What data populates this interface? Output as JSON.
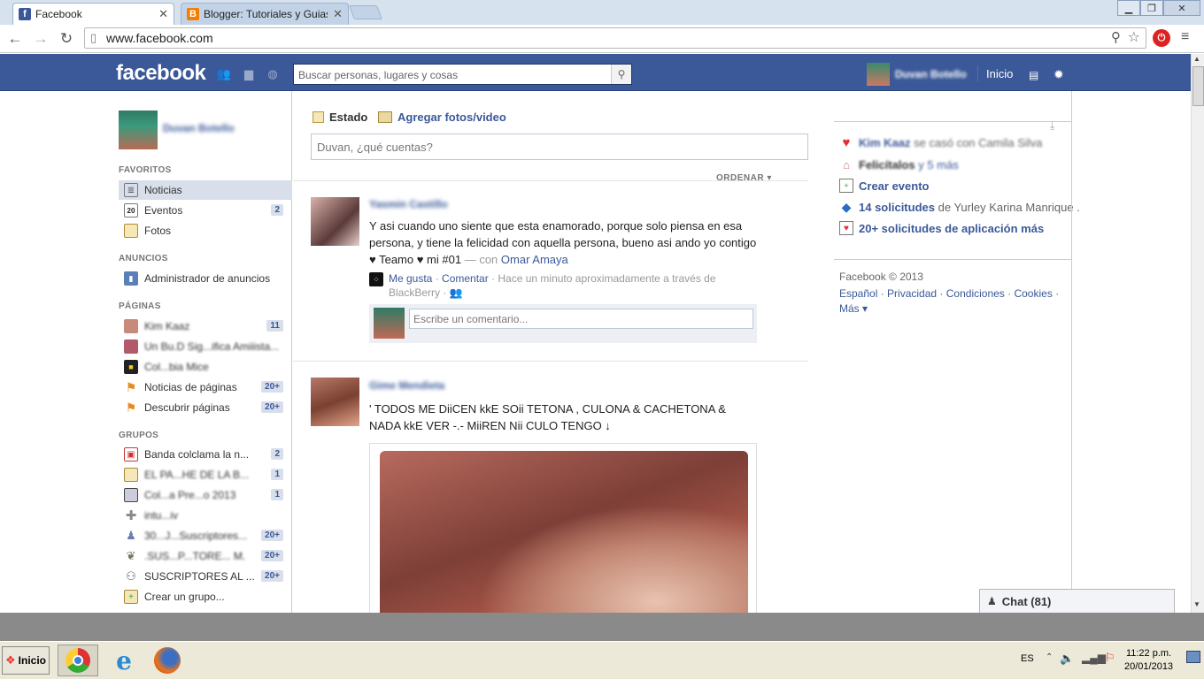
{
  "browser": {
    "tabs": [
      {
        "title": "Facebook",
        "active": true
      },
      {
        "title": "Blogger: Tutoriales y Guias. -",
        "active": false
      }
    ],
    "url": "www.facebook.com",
    "window_controls": {
      "minimize": "▭",
      "maximize": "❐",
      "close": "✕"
    }
  },
  "fbbar": {
    "logo": "facebook",
    "search_placeholder": "Buscar personas, lugares y cosas",
    "user_name": "Duvan Botello",
    "home": "Inicio"
  },
  "left": {
    "profile_name": "Duvan Botello",
    "sections": {
      "favoritos": "FAVORITOS",
      "anuncios": "ANUNCIOS",
      "paginas": "PÁGINAS",
      "grupos": "GRUPOS"
    },
    "favoritos": [
      {
        "label": "Noticias",
        "count": ""
      },
      {
        "label": "Eventos",
        "count": "2"
      },
      {
        "label": "Fotos",
        "count": ""
      }
    ],
    "anuncios": [
      {
        "label": "Administrador de anuncios",
        "count": ""
      }
    ],
    "paginas": [
      {
        "label": "Kim Kaaz",
        "count": "11"
      },
      {
        "label": "Un Bu.D Sig...ifica Amiiista...",
        "count": ""
      },
      {
        "label": "Col...bia Mice",
        "count": ""
      },
      {
        "label": "Noticias de páginas",
        "count": "20+"
      },
      {
        "label": "Descubrir páginas",
        "count": "20+"
      }
    ],
    "grupos": [
      {
        "label": "Banda colclama la n...",
        "count": "2"
      },
      {
        "label": "EL PA...HE DE LA B...",
        "count": "1"
      },
      {
        "label": "Col...a Pre...o 2013",
        "count": "1"
      },
      {
        "label": "intu...iv",
        "count": ""
      },
      {
        "label": "30...J...Suscriptores...",
        "count": "20+"
      },
      {
        "label": ".SUS...P...TORE... M.",
        "count": "20+"
      },
      {
        "label": "SUSCRIPTORES AL ...",
        "count": "20+"
      },
      {
        "label": "Crear un grupo...",
        "count": ""
      }
    ]
  },
  "composer": {
    "status_tab": "Estado",
    "photo_tab": "Agregar fotos/video",
    "placeholder": "Duvan, ¿qué cuentas?",
    "sort": "ORDENAR"
  },
  "posts": [
    {
      "author": "Yasmin Castillo",
      "text": "Y asi cuando uno siente que esta enamorado, porque solo piensa en esa persona, y tiene la felicidad con aquella persona, bueno asi ando yo contigo ♥ Teamo ♥ mi #01",
      "with_prefix": "— con",
      "with_name": "Omar Amaya",
      "like": "Me gusta",
      "comment": "Comentar",
      "meta": "Hace un minuto aproximadamente a través de BlackBerry",
      "comment_placeholder": "Escribe un comentario..."
    },
    {
      "author": "Gime Mendieta",
      "text": "' TODOS ME DiiCEN kkE SOii TETONA , CULONA & CACHETONA & NADA kkE VER -.- MiiREN Nii CULO TENGO ↓"
    }
  ],
  "right": {
    "items": [
      {
        "strong": "Kim Kaaz",
        "rest": "se casó con Camila Silva"
      },
      {
        "strong": "Felicítalos",
        "rest": "y 5 más"
      },
      {
        "strong": "Crear evento",
        "rest": ""
      },
      {
        "strong": "14 solicitudes",
        "rest": "de Yurley Karina Manrique ."
      },
      {
        "strong": "20+ solicitudes de aplicación más",
        "rest": ""
      }
    ],
    "copyright": "Facebook © 2013",
    "footer_links": [
      "Español",
      "Privacidad",
      "Condiciones",
      "Cookies",
      "Más"
    ]
  },
  "chat": {
    "label": "Chat (81)"
  },
  "taskbar": {
    "start": "Inicio",
    "lang": "ES",
    "time": "11:22 p.m.",
    "date": "20/01/2013"
  },
  "colors": {
    "fb_blue": "#3b5998",
    "fb_border": "#29447e"
  }
}
